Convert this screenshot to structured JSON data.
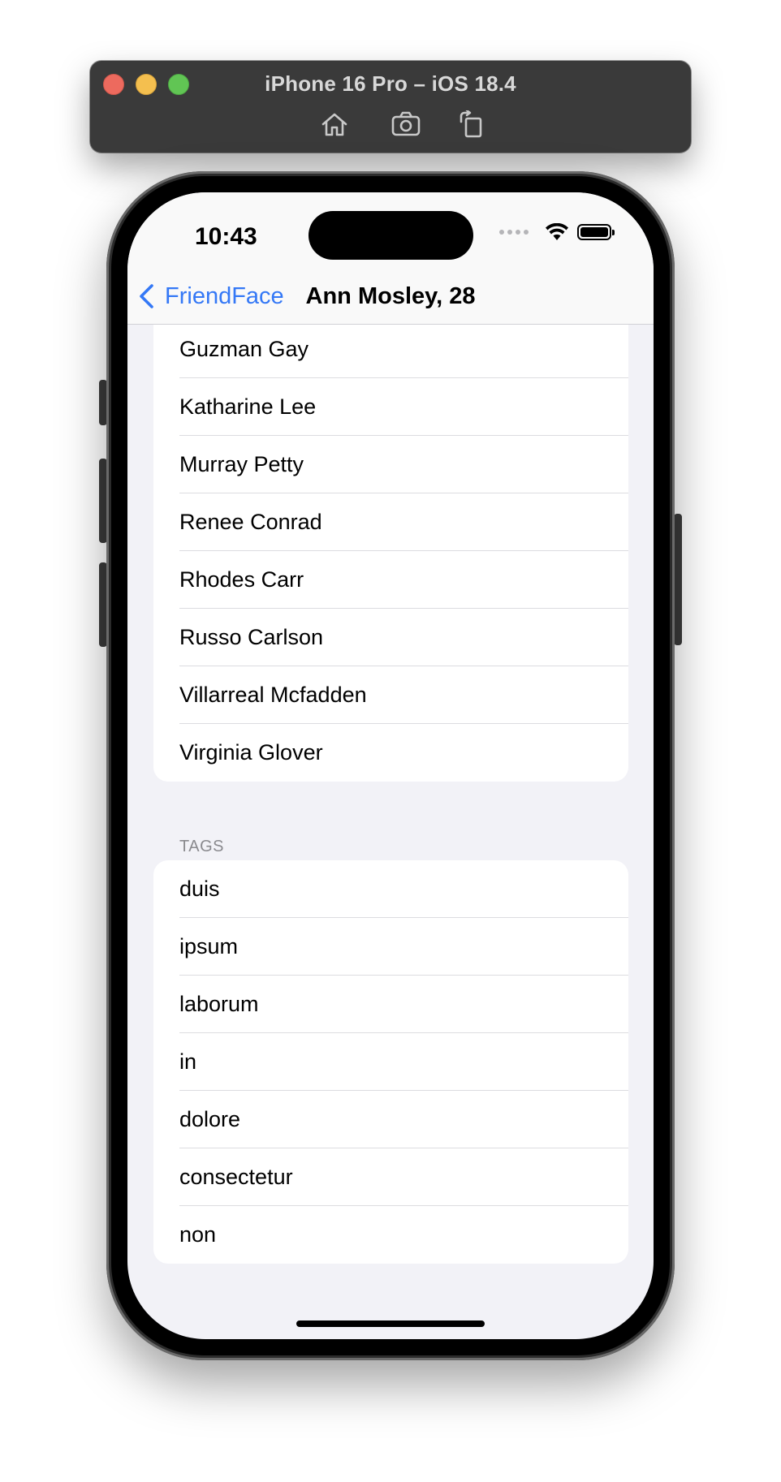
{
  "simulator": {
    "title": "iPhone 16 Pro – iOS 18.4",
    "toolbar_icons": [
      "home-icon",
      "screenshot-icon",
      "rotate-icon"
    ]
  },
  "status_bar": {
    "time": "10:43"
  },
  "nav": {
    "back_label": "FriendFace",
    "title": "Ann Mosley, 28"
  },
  "friends": [
    "Guzman Gay",
    "Katharine Lee",
    "Murray Petty",
    "Renee Conrad",
    "Rhodes Carr",
    "Russo Carlson",
    "Villarreal Mcfadden",
    "Virginia Glover"
  ],
  "tags_section": {
    "header": "TAGS",
    "items": [
      "duis",
      "ipsum",
      "laborum",
      "in",
      "dolore",
      "consectetur",
      "non"
    ]
  },
  "colors": {
    "accent": "#3478f6",
    "background": "#f2f2f7"
  }
}
